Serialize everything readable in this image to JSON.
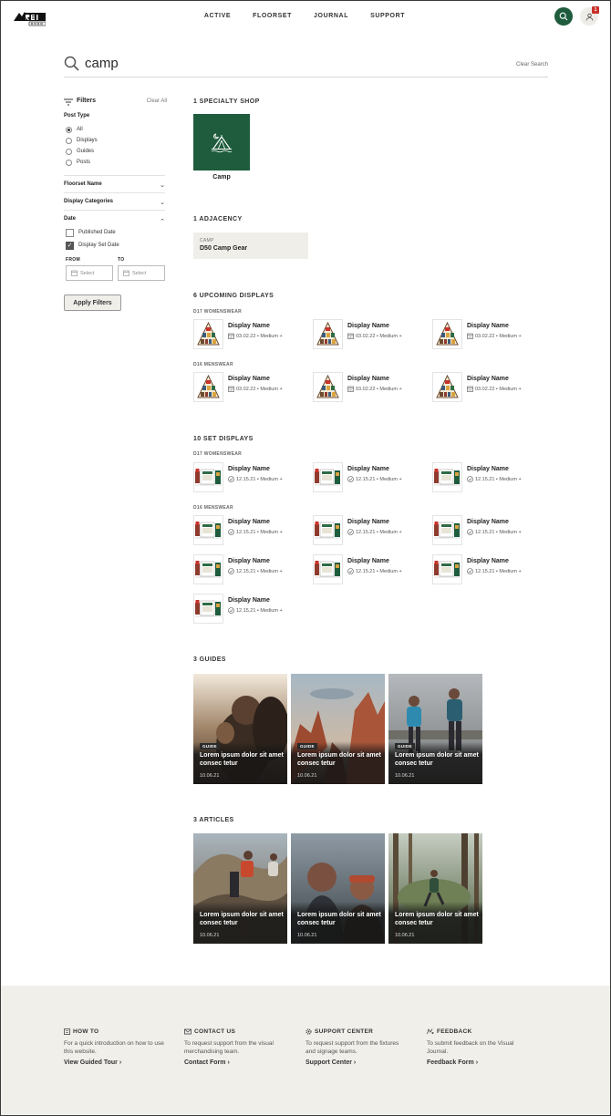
{
  "nav": [
    "ACTIVE",
    "FLOORSET",
    "JOURNAL",
    "SUPPORT"
  ],
  "header": {
    "notification_count": "1"
  },
  "search": {
    "query": "camp",
    "clear_label": "Clear Search"
  },
  "filters": {
    "title": "Filters",
    "clear_all": "Clear All",
    "post_type_label": "Post Type",
    "post_types": [
      "All",
      "Displays",
      "Guides",
      "Posts"
    ],
    "selected_post_type": "All",
    "floorset_name": "Floorset Name",
    "display_categories": "Display Categories",
    "date_label": "Date",
    "published_date": "Published Date",
    "display_set_date": "Display Set Date",
    "from_label": "FROM",
    "to_label": "TO",
    "select_placeholder": "Select",
    "apply_label": "Apply Filters"
  },
  "specialty": {
    "title": "1 SPECIALTY SHOP",
    "shop_name": "Camp"
  },
  "adjacency": {
    "title": "1 ADJACENCY",
    "key": "CAMP",
    "value": "D50 Camp Gear"
  },
  "upcoming": {
    "title": "6 UPCOMING DISPLAYS",
    "groups": [
      {
        "label": "D17 WOMENSWEAR",
        "items": [
          {
            "name": "Display Name",
            "meta": "03.02.22 • Medium +"
          },
          {
            "name": "Display Name",
            "meta": "03.02.22 • Medium +"
          },
          {
            "name": "Display Name",
            "meta": "03.02.22 • Medium +"
          }
        ]
      },
      {
        "label": "D16 MENSWEAR",
        "items": [
          {
            "name": "Display Name",
            "meta": "03.02.22 • Medium +"
          },
          {
            "name": "Display Name",
            "meta": "03.02.22 • Medium +"
          },
          {
            "name": "Display Name",
            "meta": "03.02.22 • Medium +"
          }
        ]
      }
    ]
  },
  "set_displays": {
    "title": "10 SET DISPLAYS",
    "groups": [
      {
        "label": "D17 WOMENSWEAR",
        "items": [
          {
            "name": "Display Name",
            "meta": "12.15.21 • Medium +"
          },
          {
            "name": "Display Name",
            "meta": "12.15.21 • Medium +"
          },
          {
            "name": "Display Name",
            "meta": "12.15.21 • Medium +"
          }
        ]
      },
      {
        "label": "D16 MENSWEAR",
        "items": [
          {
            "name": "Display Name",
            "meta": "12.15.21 • Medium +"
          },
          {
            "name": "Display Name",
            "meta": "12.15.21 • Medium +"
          },
          {
            "name": "Display Name",
            "meta": "12.15.21 • Medium +"
          },
          {
            "name": "Display Name",
            "meta": "12.15.21 • Medium +"
          },
          {
            "name": "Display Name",
            "meta": "12.15.21 • Medium +"
          },
          {
            "name": "Display Name",
            "meta": "12.15.21 • Medium +"
          },
          {
            "name": "Display Name",
            "meta": "12.15.21 • Medium +"
          }
        ]
      }
    ]
  },
  "guides": {
    "title": "3 GUIDES",
    "items": [
      {
        "tag": "GUIDE",
        "title": "Lorem ipsum dolor sit amet consec tetur",
        "date": "10.06.21"
      },
      {
        "tag": "GUIDE",
        "title": "Lorem ipsum dolor sit amet consec tetur",
        "date": "10.06.21"
      },
      {
        "tag": "GUIDE",
        "title": "Lorem ipsum dolor sit amet consec tetur",
        "date": "10.06.21"
      }
    ]
  },
  "articles": {
    "title": "3 ARTICLES",
    "items": [
      {
        "title": "Lorem ipsum dolor sit amet consec tetur",
        "date": "10.06.21"
      },
      {
        "title": "Lorem ipsum dolor sit amet consec tetur",
        "date": "10.06.21"
      },
      {
        "title": "Lorem ipsum dolor sit amet consec tetur",
        "date": "10.06.21"
      }
    ]
  },
  "footer": [
    {
      "icon": "book-icon",
      "heading": "HOW TO",
      "text": "For a quick introduction on how to use this website.",
      "link": "View Guided Tour"
    },
    {
      "icon": "envelope-icon",
      "heading": "CONTACT US",
      "text": "To request support from the visual merchandising team.",
      "link": "Contact Form"
    },
    {
      "icon": "gear-icon",
      "heading": "SUPPORT CENTER",
      "text": "To request support from the fixtures and signage teams.",
      "link": "Support Center"
    },
    {
      "icon": "feedback-icon",
      "heading": "FEEDBACK",
      "text": "To submit feedback on the Visual Journal.",
      "link": "Feedback Form"
    }
  ],
  "colors": {
    "brand_green": "#1f5c3d",
    "badge_red": "#c8322a",
    "footer_bg": "#f1efea"
  }
}
